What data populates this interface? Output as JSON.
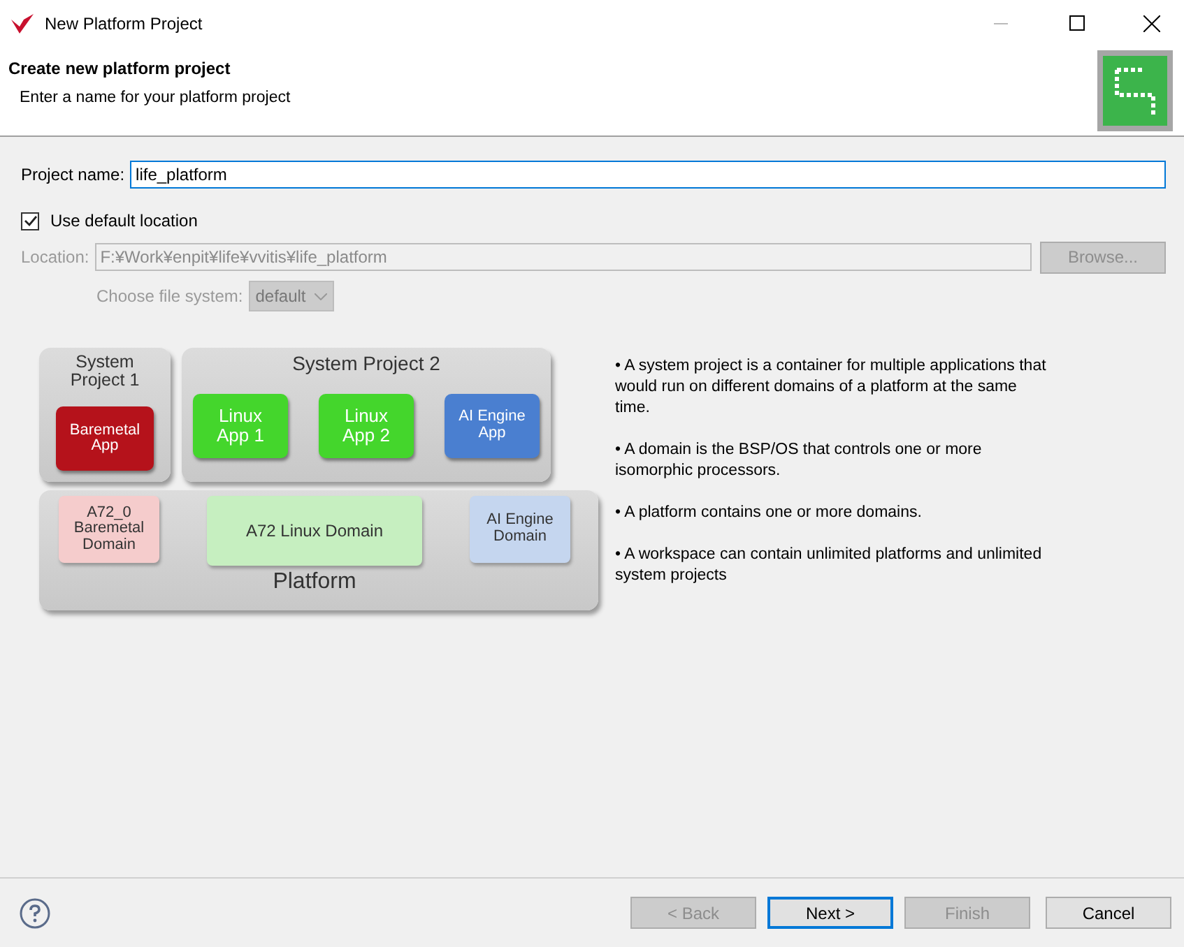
{
  "window": {
    "title": "New Platform Project"
  },
  "header": {
    "title": "Create new platform project",
    "description": "Enter a name for your platform project"
  },
  "form": {
    "project_name": {
      "label": "Project name:",
      "value": "life_platform",
      "focused": true
    },
    "use_default_location": {
      "label": "Use default location",
      "checked": true
    },
    "location": {
      "label": "Location:",
      "value": "F:¥Work¥enpit¥life¥vvitis¥life_platform",
      "disabled": true
    },
    "browse_button": {
      "label": "Browse...",
      "disabled": true
    },
    "file_system": {
      "label": "Choose file system:",
      "value": "default",
      "disabled": true
    }
  },
  "diagram": {
    "system_projects": [
      {
        "title": "System Project 1",
        "apps": [
          {
            "label": "Baremetal App",
            "color": "#b5121b"
          }
        ]
      },
      {
        "title": "System Project 2",
        "apps": [
          {
            "label": "Linux App 1",
            "color": "#44d62c"
          },
          {
            "label": "Linux App 2",
            "color": "#44d62c"
          },
          {
            "label": "AI Engine App",
            "color": "#4a7fd0"
          }
        ]
      }
    ],
    "platform": {
      "title": "Platform",
      "domains": [
        {
          "label": "A72_0 Baremetal Domain",
          "color": "#f5cccc"
        },
        {
          "label": "A72 Linux Domain",
          "color": "#c6efc0"
        },
        {
          "label": "AI Engine Domain",
          "color": "#c5d6ef"
        }
      ]
    }
  },
  "notes": [
    "• A system project is a container for multiple applications that would run on different domains of a platform at the same time.",
    "• A domain is the BSP/OS that controls one or more isomorphic processors.",
    "• A platform contains one or more domains.",
    "• A workspace can contain unlimited platforms and unlimited system projects"
  ],
  "buttons": [
    {
      "label": "< Back",
      "disabled": true,
      "default": false
    },
    {
      "label": "Next >",
      "disabled": false,
      "default": true
    },
    {
      "label": "Finish",
      "disabled": true,
      "default": false
    },
    {
      "label": "Cancel",
      "disabled": false,
      "default": false
    }
  ]
}
